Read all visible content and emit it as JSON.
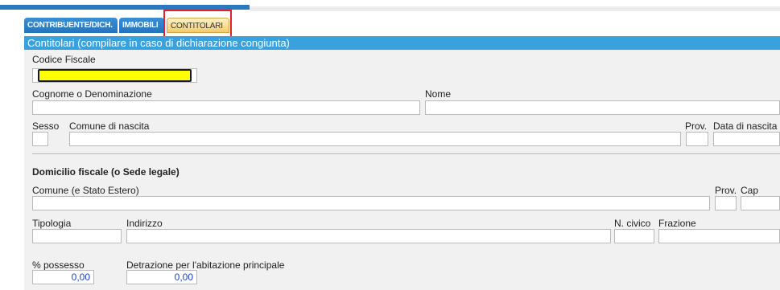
{
  "tabs": [
    {
      "label": "CONTRIBUENTE/DICH."
    },
    {
      "label": "IMMOBILI"
    },
    {
      "label": "CONTITOLARI",
      "active": true
    }
  ],
  "section_title": "Contitolari (compilare in caso di dichiarazione congiunta)",
  "fields": {
    "codice_fiscale": {
      "label": "Codice Fiscale",
      "value": ""
    },
    "cognome": {
      "label": "Cognome o Denominazione",
      "value": ""
    },
    "nome": {
      "label": "Nome",
      "value": ""
    },
    "sesso": {
      "label": "Sesso",
      "value": ""
    },
    "comune_nascita": {
      "label": "Comune di nascita",
      "value": ""
    },
    "prov_nascita": {
      "label": "Prov.",
      "value": ""
    },
    "data_nascita": {
      "label": "Data di nascita",
      "value": ""
    }
  },
  "domicilio": {
    "heading": "Domicilio fiscale (o Sede legale)",
    "comune": {
      "label": "Comune (e Stato Estero)",
      "value": ""
    },
    "prov": {
      "label": "Prov.",
      "value": ""
    },
    "cap": {
      "label": "Cap",
      "value": ""
    },
    "tipologia": {
      "label": "Tipologia",
      "value": ""
    },
    "indirizzo": {
      "label": "Indirizzo",
      "value": ""
    },
    "civico": {
      "label": "N. civico",
      "value": ""
    },
    "frazione": {
      "label": "Frazione",
      "value": ""
    },
    "possesso": {
      "label": "% possesso",
      "value": "0,00"
    },
    "detrazione": {
      "label": "Detrazione per l'abitazione principale",
      "value": "0,00"
    }
  },
  "colors": {
    "tab_blue": "#2a79c0",
    "section_blue": "#3aa1df",
    "active_tab": "#f3cb6a",
    "highlight": "#e2222c",
    "focus_field": "#ffff00"
  }
}
